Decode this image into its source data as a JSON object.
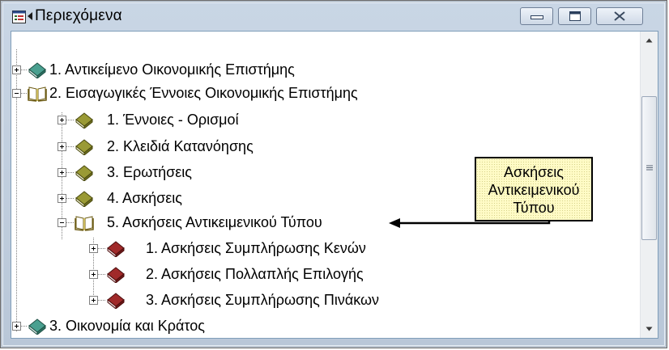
{
  "window": {
    "title": "Περιεχόμενα",
    "accent": "#c9d6e5"
  },
  "tree": {
    "items": [
      {
        "label": "1.  Αντικείμενο Οικονομικής Επιστήμης",
        "icon": "green-book-icon",
        "expanded": false
      },
      {
        "label": "2.  Εισαγωγικές Έννοιες Οικονομικής Επιστήμης",
        "icon": "open-book-icon",
        "expanded": true
      },
      {
        "label": "1.  Έννοιες - Ορισμοί",
        "icon": "olive-book-icon",
        "expanded": false
      },
      {
        "label": "2.  Κλειδιά Κατανόησης",
        "icon": "olive-book-icon",
        "expanded": false
      },
      {
        "label": "3.  Ερωτήσεις",
        "icon": "olive-book-icon",
        "expanded": false
      },
      {
        "label": "4.  Ασκήσεις",
        "icon": "olive-book-icon",
        "expanded": false
      },
      {
        "label": "5.  Ασκήσεις Αντικειμενικού Τύπου",
        "icon": "open-book-icon",
        "expanded": true
      },
      {
        "label": "1.  Ασκήσεις Συμπλήρωσης Κενών",
        "icon": "red-book-icon",
        "expanded": false
      },
      {
        "label": "2.  Ασκήσεις Πολλαπλής Επιλογής",
        "icon": "red-book-icon",
        "expanded": false
      },
      {
        "label": "3.  Ασκήσεις Συμπλήρωσης Πινάκων",
        "icon": "red-book-icon",
        "expanded": false
      },
      {
        "label": "3.  Οικονομία και Κράτος",
        "icon": "green-book-icon",
        "expanded": false
      }
    ]
  },
  "callout": {
    "line1": "Ασκήσεις",
    "line2": "Αντικειμενικού",
    "line3": "Τύπου"
  },
  "colors": {
    "green_book": "#3d8c7c",
    "olive_book": "#8b8b2a",
    "red_book": "#8c1e1e",
    "callout_bg": "#fffbc6"
  }
}
